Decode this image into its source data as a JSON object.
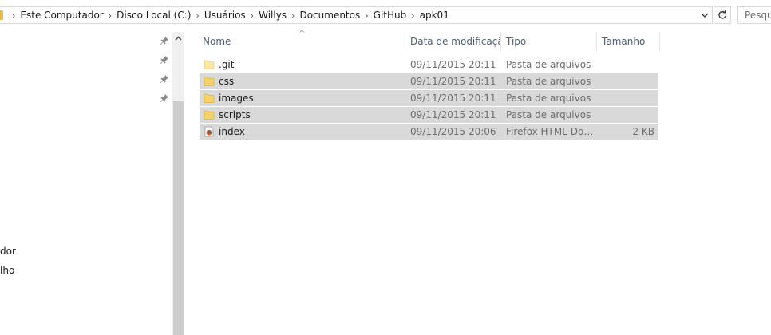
{
  "address": {
    "breadcrumb": [
      "Este Computador",
      "Disco Local (C:)",
      "Usuários",
      "Willys",
      "Documentos",
      "GitHub",
      "apk01"
    ]
  },
  "search": {
    "placeholder": "Pesquisar"
  },
  "nav": {
    "labels": [
      "dor",
      "lho"
    ]
  },
  "columns": {
    "name": "Nome",
    "date": "Data de modificação",
    "type": "Tipo",
    "size": "Tamanho"
  },
  "files": [
    {
      "name": ".git",
      "date": "09/11/2015 20:11",
      "type": "Pasta de arquivos",
      "size": "",
      "icon": "folder-icon",
      "selected": false
    },
    {
      "name": "css",
      "date": "09/11/2015 20:11",
      "type": "Pasta de arquivos",
      "size": "",
      "icon": "folder-icon",
      "selected": true
    },
    {
      "name": "images",
      "date": "09/11/2015 20:11",
      "type": "Pasta de arquivos",
      "size": "",
      "icon": "folder-icon",
      "selected": true
    },
    {
      "name": "scripts",
      "date": "09/11/2015 20:11",
      "type": "Pasta de arquivos",
      "size": "",
      "icon": "folder-icon",
      "selected": true
    },
    {
      "name": "index",
      "date": "09/11/2015 20:06",
      "type": "Firefox HTML Doc...",
      "size": "2 KB",
      "icon": "firefox-html-icon",
      "selected": true
    }
  ],
  "colors": {
    "folder": "#f4d36b",
    "folder_dark": "#e2b33c",
    "selection": "#d9d9d9",
    "header_text": "#4c607a"
  }
}
